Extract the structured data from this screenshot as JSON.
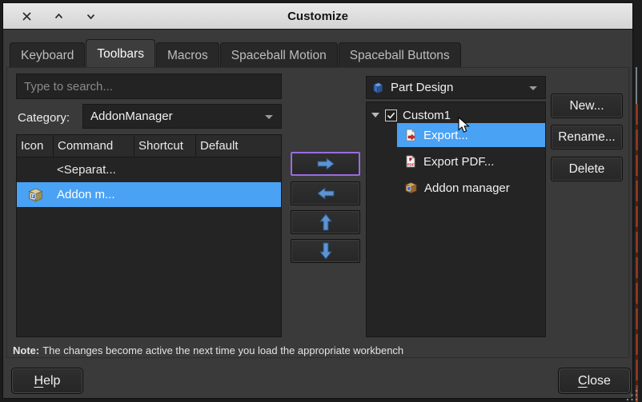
{
  "window": {
    "title": "Customize"
  },
  "tabs": [
    {
      "label": "Keyboard"
    },
    {
      "label": "Toolbars"
    },
    {
      "label": "Macros"
    },
    {
      "label": "Spaceball Motion"
    },
    {
      "label": "Spaceball Buttons"
    }
  ],
  "left_panel": {
    "search_placeholder": "Type to search...",
    "category_label": "Category:",
    "category_value": "AddonManager",
    "table": {
      "columns": [
        "Icon",
        "Command",
        "Shortcut",
        "Default"
      ],
      "rows": [
        {
          "icon": "",
          "command": "<Separat...",
          "selected": false
        },
        {
          "icon": "addon-manager-box-icon",
          "command": "Addon m...",
          "selected": true
        }
      ]
    }
  },
  "move_buttons": {
    "right_icon": "arrow-right-icon",
    "left_icon": "arrow-left-icon",
    "up_icon": "arrow-up-icon",
    "down_icon": "arrow-down-icon"
  },
  "right_panel": {
    "workbench_icon": "part-design-icon",
    "workbench_value": "Part Design",
    "tree": {
      "root_label": "Custom1",
      "root_checked": true,
      "items": [
        {
          "icon": "export-file-icon",
          "label": "Export...",
          "selected": true
        },
        {
          "icon": "export-pdf-icon",
          "label": "Export PDF...",
          "selected": false
        },
        {
          "icon": "addon-manager-box-icon",
          "label": "Addon manager",
          "selected": false
        }
      ]
    },
    "buttons": {
      "new": "New...",
      "rename": "Rename...",
      "delete": "Delete"
    }
  },
  "note": {
    "prefix": "Note:",
    "text": "The changes become active the next time you load the appropriate workbench"
  },
  "footer": {
    "help": {
      "accel": "H",
      "rest": "elp"
    },
    "close": {
      "accel": "C",
      "rest": "lose"
    }
  },
  "colors": {
    "selection_blue": "#4aa2f5",
    "focus_outline_purple": "#9a6be0",
    "titlebar_bg": "#dcdcdc",
    "arrow_blue": "#5e93d2",
    "panel_bg": "#242424",
    "dialog_bg": "#3a3a3a",
    "edge_red": "#8c3620"
  }
}
